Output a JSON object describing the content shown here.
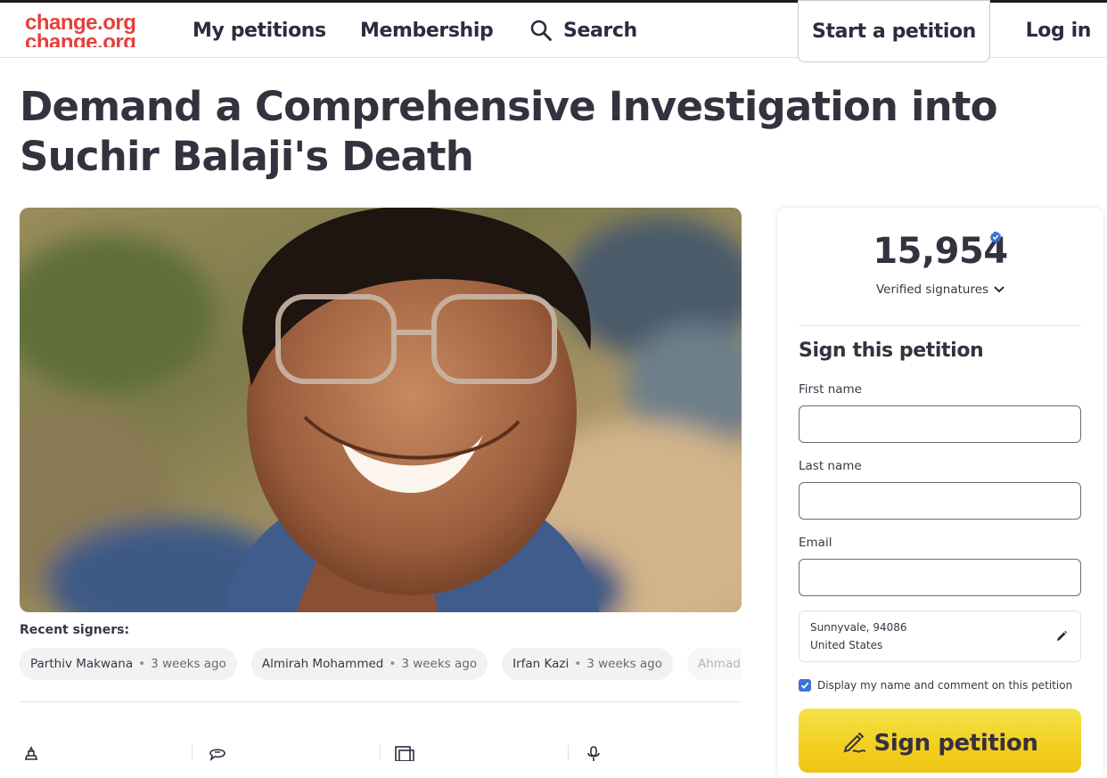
{
  "header": {
    "logo_text": "change.org",
    "nav": {
      "my_petitions": "My petitions",
      "membership": "Membership",
      "search": "Search"
    },
    "start_petition": "Start a petition",
    "login": "Log in"
  },
  "petition": {
    "title": "Demand a Comprehensive Investigation into Suchir Balaji's Death",
    "recent_signers_label": "Recent signers:",
    "recent_signers": [
      {
        "name": "Parthiv Makwana",
        "time": "3 weeks ago"
      },
      {
        "name": "Almirah Mohammed",
        "time": "3 weeks ago"
      },
      {
        "name": "Irfan Kazi",
        "time": "3 weeks ago"
      },
      {
        "name": "Ahmad Durden",
        "time": ""
      }
    ]
  },
  "sign_card": {
    "count": "15,954",
    "verified_label": "Verified signatures",
    "title": "Sign this petition",
    "first_name_label": "First name",
    "last_name_label": "Last name",
    "email_label": "Email",
    "first_name_value": "",
    "last_name_value": "",
    "email_value": "",
    "location_line1": "Sunnyvale, 94086",
    "location_line2": "United States",
    "display_checkbox_label": "Display my name and comment on this petition",
    "display_checked": true,
    "sign_button": "Sign petition"
  },
  "colors": {
    "brand_red": "#e3413c",
    "sign_button_yellow": "#f2cf1d",
    "verified_blue": "#3b73d6",
    "text_dark": "#36313f"
  },
  "icons": [
    "search-icon",
    "verified-badge-icon",
    "chevron-down-icon",
    "pencil-icon",
    "checkbox-check-icon",
    "sign-pen-icon"
  ]
}
